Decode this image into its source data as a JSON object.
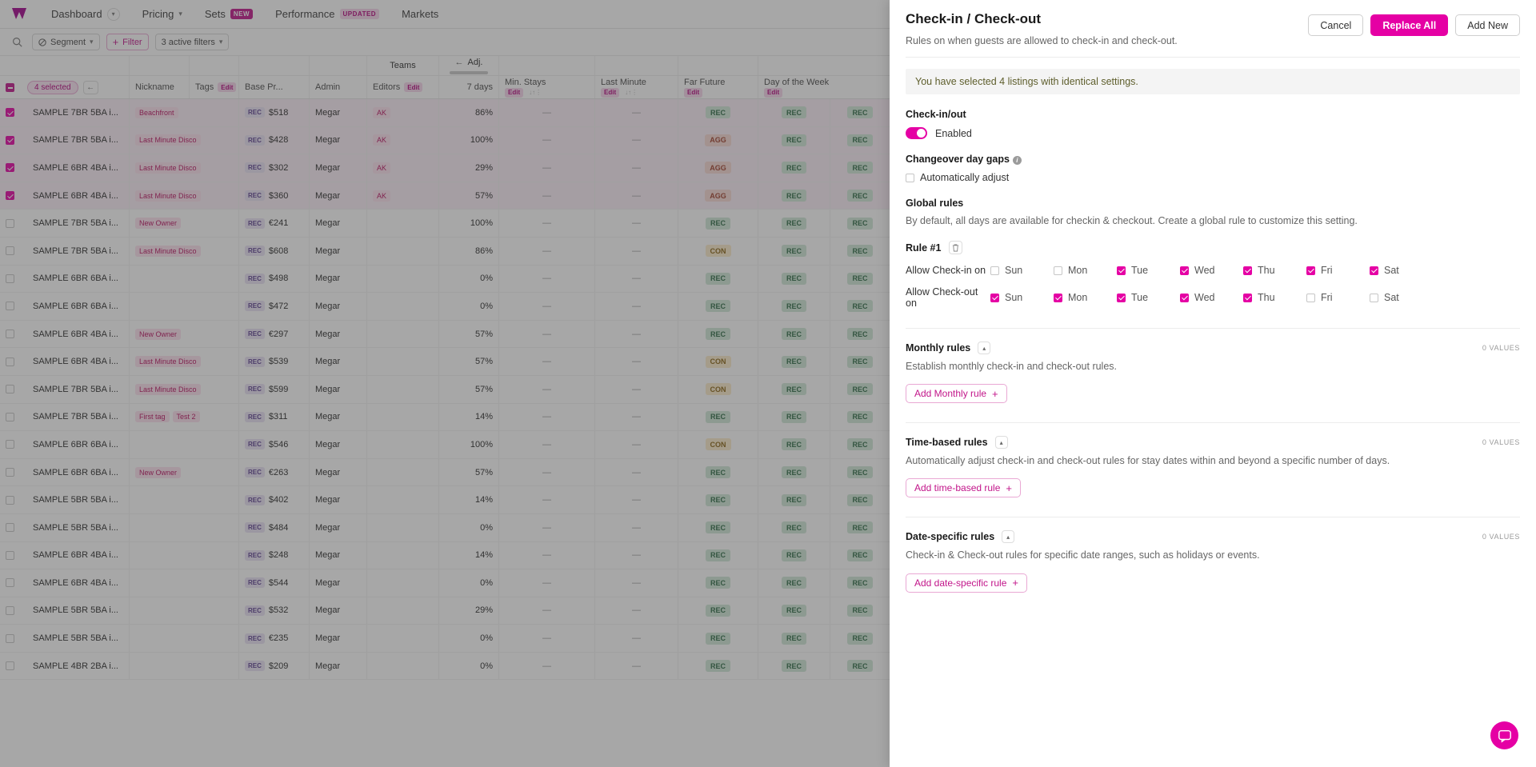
{
  "nav": {
    "logo_icon": "wheelhouse-logo-icon",
    "items": [
      {
        "label": "Dashboard",
        "chevron": true,
        "badge": null
      },
      {
        "label": "Pricing",
        "chevron": true,
        "badge": null
      },
      {
        "label": "Sets",
        "chevron": false,
        "badge": "NEW",
        "badge_kind": "new"
      },
      {
        "label": "Performance",
        "chevron": false,
        "badge": "UPDATED",
        "badge_kind": "updated"
      },
      {
        "label": "Markets",
        "chevron": false,
        "badge": null
      }
    ]
  },
  "filterbar": {
    "search_icon": "search-icon",
    "segment_label": "Segment",
    "filter_label": "Filter",
    "active_filters_label": "3 active filters"
  },
  "table": {
    "group_headers": [
      {
        "label": "Teams"
      },
      {
        "label": "Adj."
      }
    ],
    "selection_label": "4 selected",
    "back_arrow": "←",
    "columns": [
      {
        "label": "Nickname"
      },
      {
        "label": "Tags",
        "edit": "Edit"
      },
      {
        "label": "Base Pr..."
      },
      {
        "label": "Admin"
      },
      {
        "label": "Editors",
        "edit": "Edit"
      },
      {
        "label": "7 days"
      },
      {
        "label": "Min. Stays",
        "edit": "Edit"
      },
      {
        "label": "Last Minute",
        "edit": "Edit"
      },
      {
        "label": "Far Future",
        "edit": "Edit"
      },
      {
        "label": "Day of the Week",
        "edit": "Edit"
      }
    ],
    "rows": [
      {
        "sel": true,
        "nickname": "SAMPLE 7BR 5BA i...",
        "tags": [
          "Beachfront"
        ],
        "price": "$518",
        "admin": "Megar",
        "editors": "AK",
        "pct": "86%",
        "minstays": "—",
        "lastminute": "—",
        "farfuture": "REC",
        "dow1": "REC",
        "dow2": "REC"
      },
      {
        "sel": true,
        "nickname": "SAMPLE 7BR 5BA i...",
        "tags": [
          "Last Minute Disco"
        ],
        "price": "$428",
        "admin": "Megar",
        "editors": "AK",
        "pct": "100%",
        "minstays": "—",
        "lastminute": "—",
        "farfuture": "AGG",
        "dow1": "REC",
        "dow2": "REC"
      },
      {
        "sel": true,
        "nickname": "SAMPLE 6BR 4BA i...",
        "tags": [
          "Last Minute Disco"
        ],
        "price": "$302",
        "admin": "Megar",
        "editors": "AK",
        "pct": "29%",
        "minstays": "—",
        "lastminute": "—",
        "farfuture": "AGG",
        "dow1": "REC",
        "dow2": "REC"
      },
      {
        "sel": true,
        "nickname": "SAMPLE 6BR 4BA i...",
        "tags": [
          "Last Minute Disco"
        ],
        "price": "$360",
        "admin": "Megar",
        "editors": "AK",
        "pct": "57%",
        "minstays": "—",
        "lastminute": "—",
        "farfuture": "AGG",
        "dow1": "REC",
        "dow2": "REC"
      },
      {
        "sel": false,
        "nickname": "SAMPLE 7BR 5BA i...",
        "tags": [
          "New Owner"
        ],
        "price": "€241",
        "admin": "Megar",
        "editors": "",
        "pct": "100%",
        "minstays": "—",
        "lastminute": "—",
        "farfuture": "REC",
        "dow1": "REC",
        "dow2": "REC"
      },
      {
        "sel": false,
        "nickname": "SAMPLE 7BR 5BA i...",
        "tags": [
          "Last Minute Disco"
        ],
        "price": "$608",
        "admin": "Megar",
        "editors": "",
        "pct": "86%",
        "minstays": "—",
        "lastminute": "—",
        "farfuture": "CON",
        "dow1": "REC",
        "dow2": "REC"
      },
      {
        "sel": false,
        "nickname": "SAMPLE 6BR 6BA i...",
        "tags": [],
        "price": "$498",
        "admin": "Megar",
        "editors": "",
        "pct": "0%",
        "minstays": "—",
        "lastminute": "—",
        "farfuture": "REC",
        "dow1": "REC",
        "dow2": "REC"
      },
      {
        "sel": false,
        "nickname": "SAMPLE 6BR 6BA i...",
        "tags": [],
        "price": "$472",
        "admin": "Megar",
        "editors": "",
        "pct": "0%",
        "minstays": "—",
        "lastminute": "—",
        "farfuture": "REC",
        "dow1": "REC",
        "dow2": "REC"
      },
      {
        "sel": false,
        "nickname": "SAMPLE 6BR 4BA i...",
        "tags": [
          "New Owner"
        ],
        "price": "€297",
        "admin": "Megar",
        "editors": "",
        "pct": "57%",
        "minstays": "—",
        "lastminute": "—",
        "farfuture": "REC",
        "dow1": "REC",
        "dow2": "REC"
      },
      {
        "sel": false,
        "nickname": "SAMPLE 6BR 4BA i...",
        "tags": [
          "Last Minute Disco"
        ],
        "price": "$539",
        "admin": "Megar",
        "editors": "",
        "pct": "57%",
        "minstays": "—",
        "lastminute": "—",
        "farfuture": "CON",
        "dow1": "REC",
        "dow2": "REC"
      },
      {
        "sel": false,
        "nickname": "SAMPLE 7BR 5BA i...",
        "tags": [
          "Last Minute Disco"
        ],
        "price": "$599",
        "admin": "Megar",
        "editors": "",
        "pct": "57%",
        "minstays": "—",
        "lastminute": "—",
        "farfuture": "CON",
        "dow1": "REC",
        "dow2": "REC"
      },
      {
        "sel": false,
        "nickname": "SAMPLE 7BR 5BA i...",
        "tags": [
          "First tag",
          "Test 2"
        ],
        "price": "$311",
        "admin": "Megar",
        "editors": "",
        "pct": "14%",
        "minstays": "—",
        "lastminute": "—",
        "farfuture": "REC",
        "dow1": "REC",
        "dow2": "REC"
      },
      {
        "sel": false,
        "nickname": "SAMPLE 6BR 6BA i...",
        "tags": [],
        "price": "$546",
        "admin": "Megar",
        "editors": "",
        "pct": "100%",
        "minstays": "—",
        "lastminute": "—",
        "farfuture": "CON",
        "dow1": "REC",
        "dow2": "REC"
      },
      {
        "sel": false,
        "nickname": "SAMPLE 6BR 6BA i...",
        "tags": [
          "New Owner"
        ],
        "price": "€263",
        "admin": "Megar",
        "editors": "",
        "pct": "57%",
        "minstays": "—",
        "lastminute": "—",
        "farfuture": "REC",
        "dow1": "REC",
        "dow2": "REC"
      },
      {
        "sel": false,
        "nickname": "SAMPLE 5BR 5BA i...",
        "tags": [],
        "price": "$402",
        "admin": "Megar",
        "editors": "",
        "pct": "14%",
        "minstays": "—",
        "lastminute": "—",
        "farfuture": "REC",
        "dow1": "REC",
        "dow2": "REC"
      },
      {
        "sel": false,
        "nickname": "SAMPLE 5BR 5BA i...",
        "tags": [],
        "price": "$484",
        "admin": "Megar",
        "editors": "",
        "pct": "0%",
        "minstays": "—",
        "lastminute": "—",
        "farfuture": "REC",
        "dow1": "REC",
        "dow2": "REC"
      },
      {
        "sel": false,
        "nickname": "SAMPLE 6BR 4BA i...",
        "tags": [],
        "price": "$248",
        "admin": "Megar",
        "editors": "",
        "pct": "14%",
        "minstays": "—",
        "lastminute": "—",
        "farfuture": "REC",
        "dow1": "REC",
        "dow2": "REC"
      },
      {
        "sel": false,
        "nickname": "SAMPLE 6BR 4BA i...",
        "tags": [],
        "price": "$544",
        "admin": "Megar",
        "editors": "",
        "pct": "0%",
        "minstays": "—",
        "lastminute": "—",
        "farfuture": "REC",
        "dow1": "REC",
        "dow2": "REC"
      },
      {
        "sel": false,
        "nickname": "SAMPLE 5BR 5BA i...",
        "tags": [],
        "price": "$532",
        "admin": "Megar",
        "editors": "",
        "pct": "29%",
        "minstays": "—",
        "lastminute": "—",
        "farfuture": "REC",
        "dow1": "REC",
        "dow2": "REC"
      },
      {
        "sel": false,
        "nickname": "SAMPLE 5BR 5BA i...",
        "tags": [],
        "price": "€235",
        "admin": "Megar",
        "editors": "",
        "pct": "0%",
        "minstays": "—",
        "lastminute": "—",
        "farfuture": "REC",
        "dow1": "REC",
        "dow2": "REC"
      },
      {
        "sel": false,
        "nickname": "SAMPLE 4BR 2BA i...",
        "tags": [],
        "price": "$209",
        "admin": "Megar",
        "editors": "",
        "pct": "0%",
        "minstays": "—",
        "lastminute": "—",
        "farfuture": "REC",
        "dow1": "REC",
        "dow2": "REC"
      }
    ],
    "rec_tag": "REC"
  },
  "panel": {
    "title": "Check-in / Check-out",
    "subtitle": "Rules on when guests are allowed to check-in and check-out.",
    "buttons": {
      "cancel": "Cancel",
      "replace_all": "Replace All",
      "add_new": "Add New"
    },
    "notice": "You have selected 4 listings with identical settings.",
    "checkinout": {
      "label": "Check-in/out",
      "toggle_label": "Enabled",
      "toggle_on": true
    },
    "changeover": {
      "label": "Changeover day gaps",
      "info_icon": "info-icon",
      "checkbox_label": "Automatically adjust",
      "checked": false
    },
    "global_rules": {
      "label": "Global rules",
      "description": "By default, all days are available for checkin & checkout. Create a global rule to customize this setting.",
      "rule_name": "Rule #1",
      "delete_icon": "trash-icon",
      "checkin_label": "Allow Check-in on",
      "checkout_label": "Allow Check-out on",
      "days": [
        "Sun",
        "Mon",
        "Tue",
        "Wed",
        "Thu",
        "Fri",
        "Sat"
      ],
      "checkin_values": [
        false,
        false,
        true,
        true,
        true,
        true,
        true
      ],
      "checkout_values": [
        true,
        true,
        true,
        true,
        true,
        false,
        false
      ]
    },
    "monthly": {
      "title": "Monthly rules",
      "values_label": "0 VALUES",
      "description": "Establish monthly check-in and check-out rules.",
      "add_label": "Add Monthly rule"
    },
    "timebased": {
      "title": "Time-based rules",
      "values_label": "0 VALUES",
      "description": "Automatically adjust check-in and check-out rules for stay dates within and beyond a specific number of days.",
      "add_label": "Add time-based rule"
    },
    "datespecific": {
      "title": "Date-specific rules",
      "values_label": "0 VALUES",
      "description": "Check-in & Check-out rules for specific date ranges, such as holidays or events.",
      "add_label": "Add date-specific rule"
    },
    "chat_icon": "chat-bubble-icon"
  },
  "colors": {
    "accent": "#e500a4",
    "accent_dark": "#c2158a"
  }
}
